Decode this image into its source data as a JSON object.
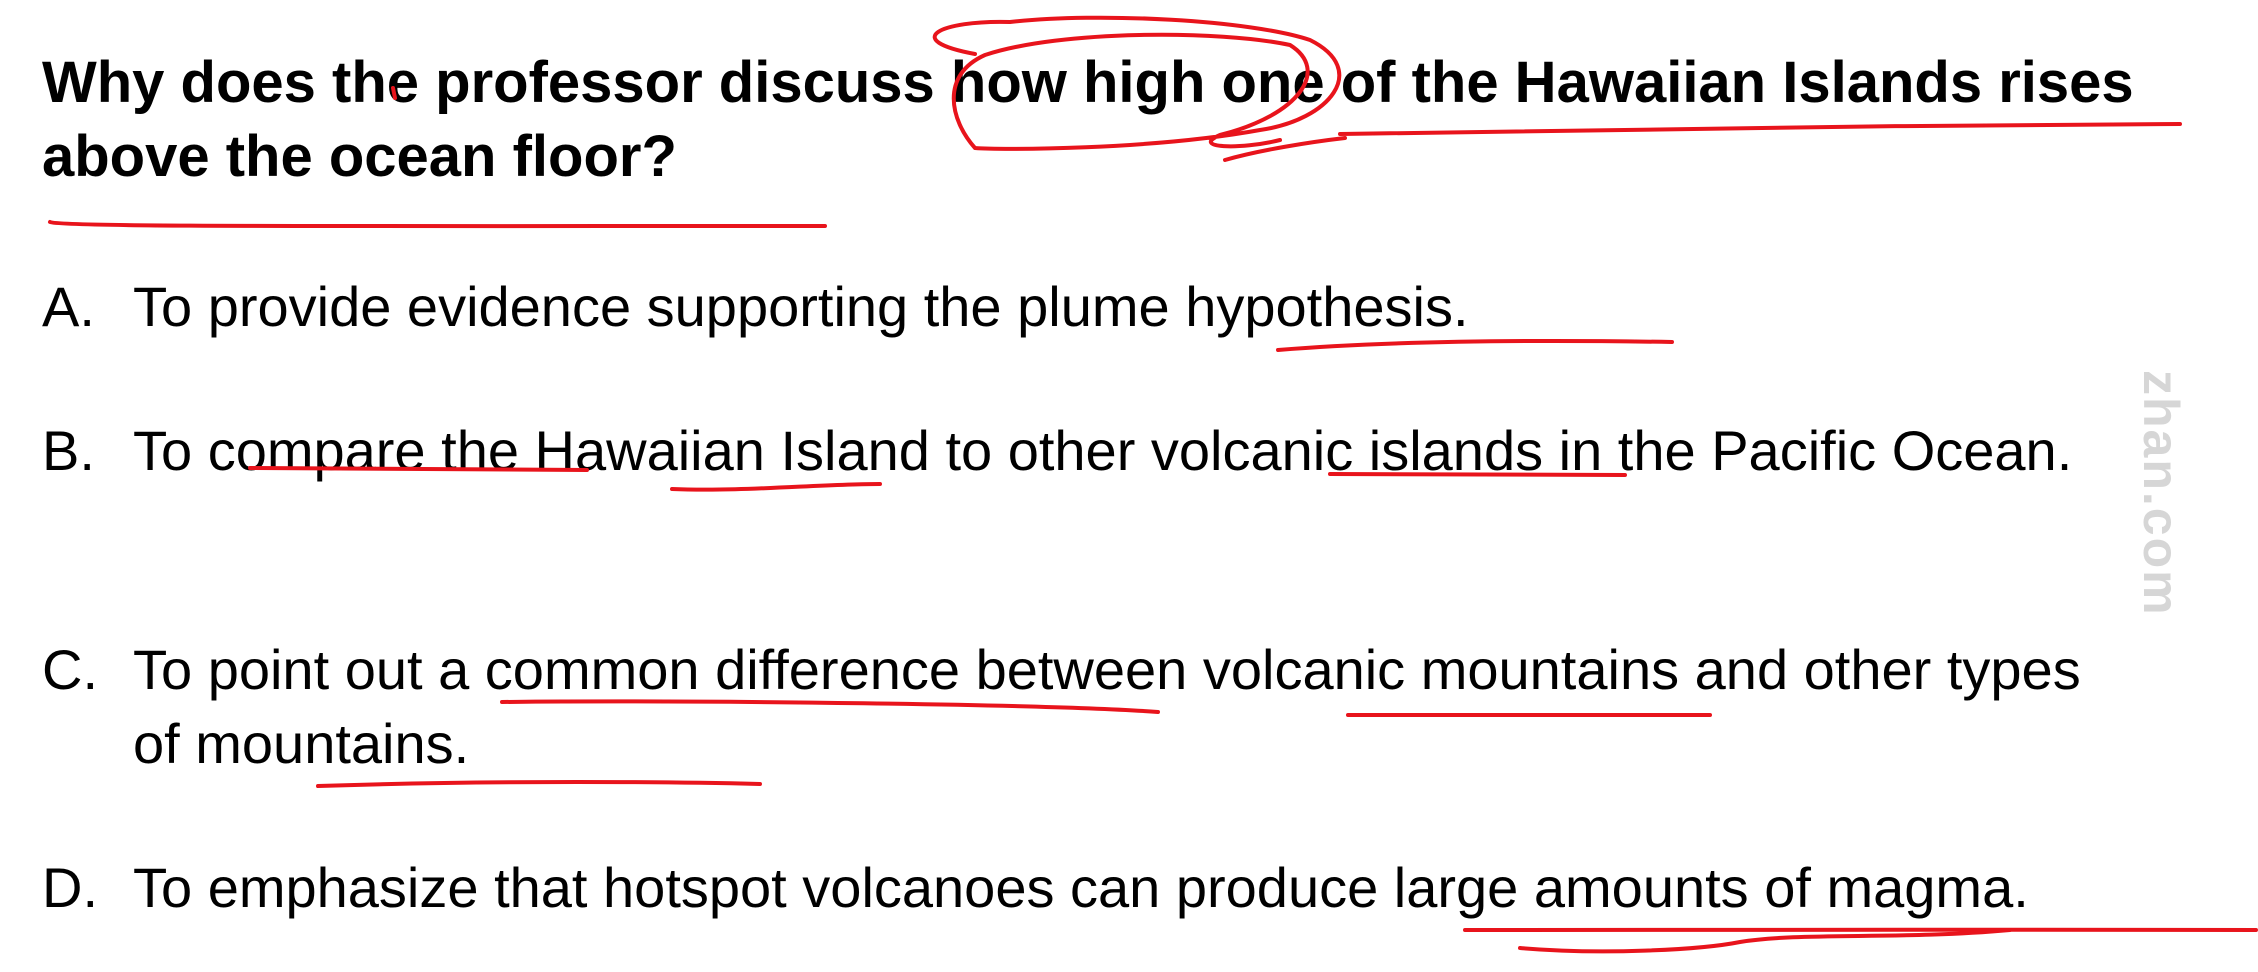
{
  "question": "Why does the professor discuss how high one of the Hawaiian Islands rises above the ocean floor?",
  "options": [
    {
      "letter": "A.",
      "text": "To provide evidence supporting the plume hypothesis."
    },
    {
      "letter": "B.",
      "text": "To compare the Hawaiian Island to other volcanic islands in the Pacific Ocean."
    },
    {
      "letter": "C.",
      "text": "To point out a common difference between volcanic mountains and other types of mountains."
    },
    {
      "letter": "D.",
      "text": "To emphasize that hotspot volcanoes can produce large amounts of magma."
    }
  ],
  "watermark": "zhan.com",
  "annotation_color": "#e8141c"
}
